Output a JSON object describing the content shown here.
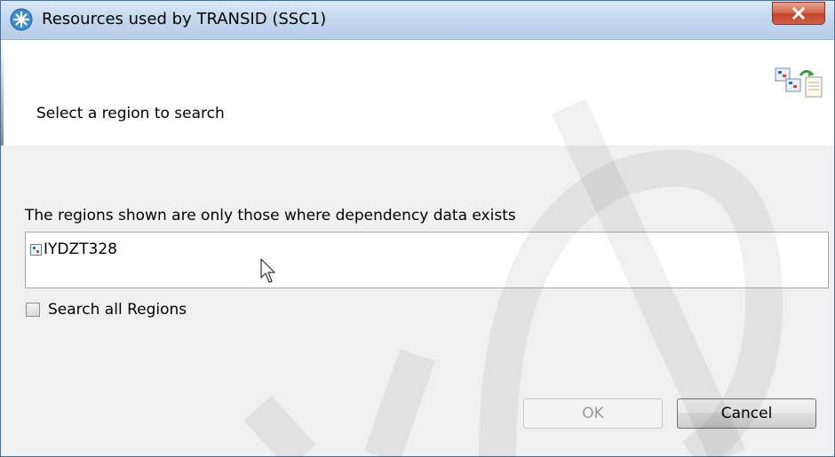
{
  "window": {
    "title": "Resources used by  TRANSID (SSC1)",
    "close_icon": "close-icon"
  },
  "header": {
    "message": "Select a region to search",
    "icon": "wizard-banner-icon"
  },
  "regions": {
    "label": "The regions shown are only those where dependency data exists",
    "items": [
      {
        "label": "IYDZT328",
        "icon": "region-icon"
      }
    ]
  },
  "options": {
    "search_all_label": "Search all Regions",
    "search_all_checked": false
  },
  "buttons": {
    "ok_label": "OK",
    "ok_enabled": false,
    "cancel_label": "Cancel"
  },
  "colors": {
    "titlebar": "#c4d8ee",
    "close": "#c4432b",
    "dialog_bg": "#f0f0f0"
  }
}
